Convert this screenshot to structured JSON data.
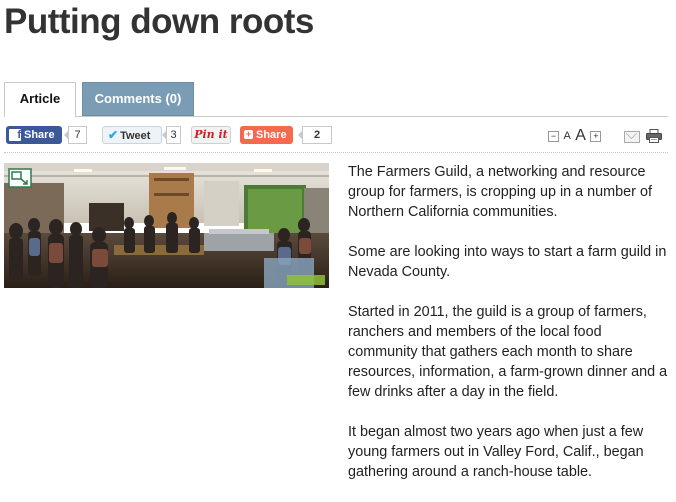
{
  "page": {
    "title": "Putting down roots"
  },
  "tabs": [
    {
      "label": "Article",
      "active": true
    },
    {
      "label": "Comments (0)",
      "active": false
    }
  ],
  "share": {
    "facebook_label": "Share",
    "facebook_count": "7",
    "twitter_label": "Tweet",
    "twitter_count": "3",
    "pinterest_label": "Pin it",
    "addthis_label": "Share",
    "addthis_count": "2"
  },
  "font_controls": {
    "small": "A",
    "large": "A",
    "decrease": "−",
    "increase": "+"
  },
  "icons": {
    "facebook": "facebook-icon",
    "twitter": "twitter-bird-icon",
    "addthis": "plus-icon",
    "email": "email-icon",
    "print": "printer-icon",
    "expand": "expand-image-icon"
  },
  "colors": {
    "facebook": "#3b5998",
    "comments_tab": "#7a9db5",
    "addthis": "#f36a4f",
    "pinterest": "#cb2027"
  },
  "article": {
    "paragraphs": [
      "The Farmers Guild, a networking and resource group for farmers, is cropping up in a number of Northern California communities.",
      "Some are looking into ways to start a farm guild in Nevada County.",
      "Started in 2011, the guild is a group of farmers, ranchers and members of the local food community that gathers each month to share resources, information, a farm-grown dinner and a few drinks after a day in the field.",
      "It began almost two years ago when just a few young farmers out in Valley Ford, Calif., began gathering around a ranch-house table."
    ]
  }
}
